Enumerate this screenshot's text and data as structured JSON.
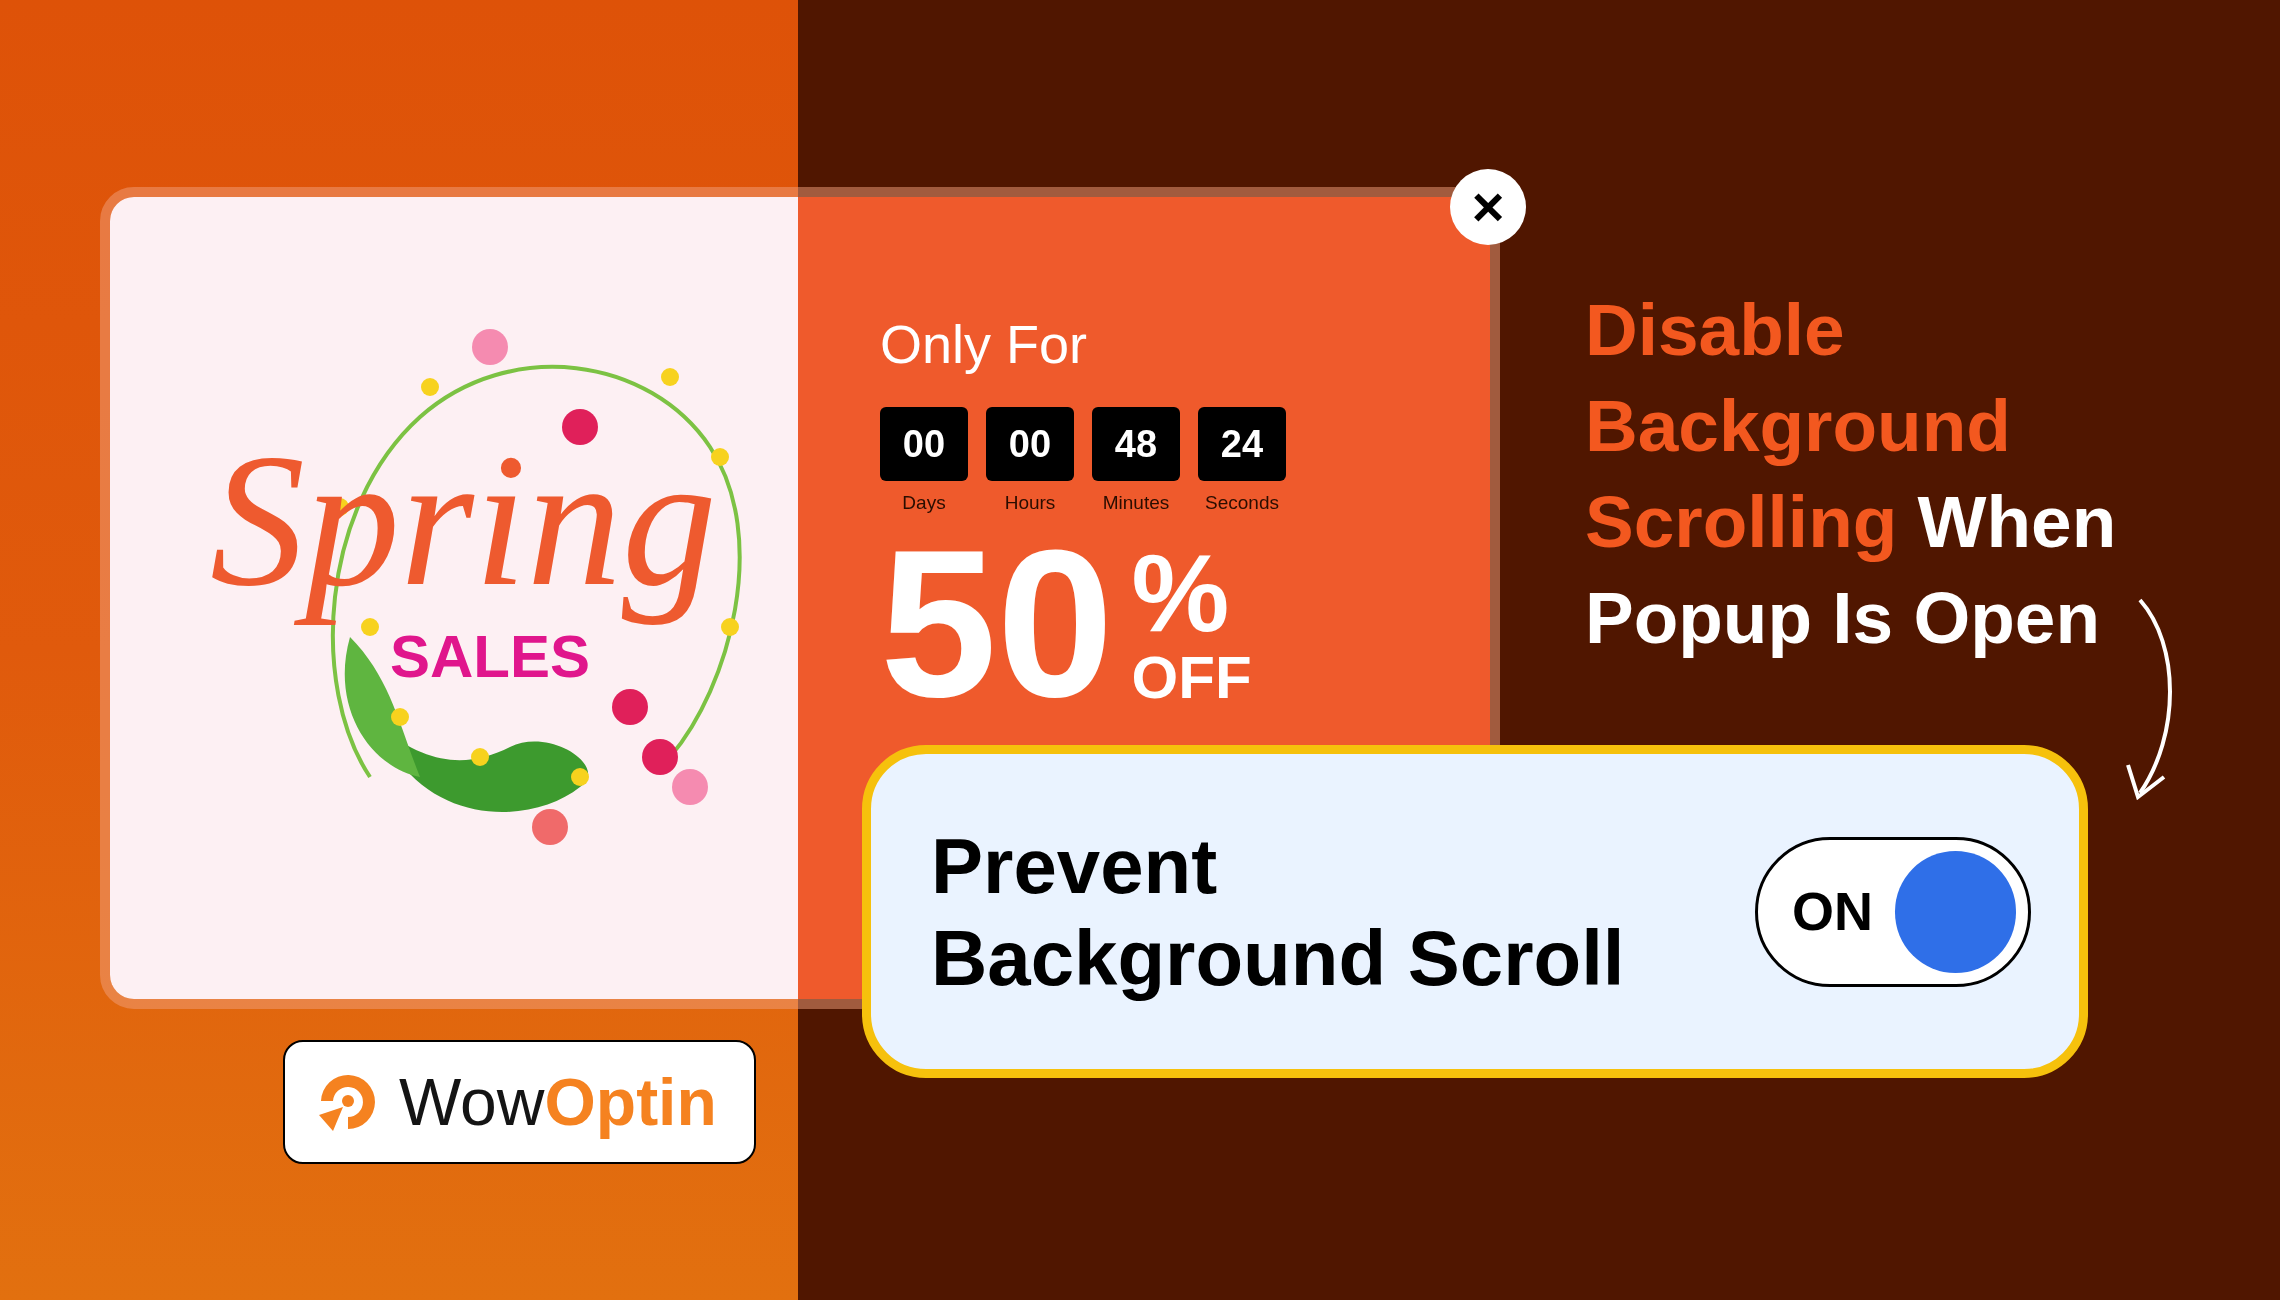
{
  "popup": {
    "artwork": {
      "title": "Spring",
      "subtitle": "SALES"
    },
    "offer": {
      "lead": "Only For",
      "countdown": [
        {
          "value": "00",
          "unit": "Days"
        },
        {
          "value": "00",
          "unit": "Hours"
        },
        {
          "value": "48",
          "unit": "Minutes"
        },
        {
          "value": "24",
          "unit": "Seconds"
        }
      ],
      "amount": "50",
      "percent": "%",
      "off": "OFF"
    },
    "close_label": "×"
  },
  "headline": {
    "lines": [
      [
        {
          "text": "Disable",
          "accent": true
        }
      ],
      [
        {
          "text": "Background",
          "accent": true
        }
      ],
      [
        {
          "text": "Scrolling",
          "accent": true
        },
        {
          "text": " When",
          "accent": false
        }
      ],
      [
        {
          "text": "Popup Is Open",
          "accent": false
        }
      ]
    ]
  },
  "setting": {
    "label_lines": [
      "Prevent",
      "Background Scroll"
    ],
    "toggle": {
      "label": "ON",
      "on": true
    }
  },
  "logo": {
    "parts": [
      {
        "text": "Wow",
        "accent": false
      },
      {
        "text": "Optin",
        "accent": true
      }
    ]
  }
}
